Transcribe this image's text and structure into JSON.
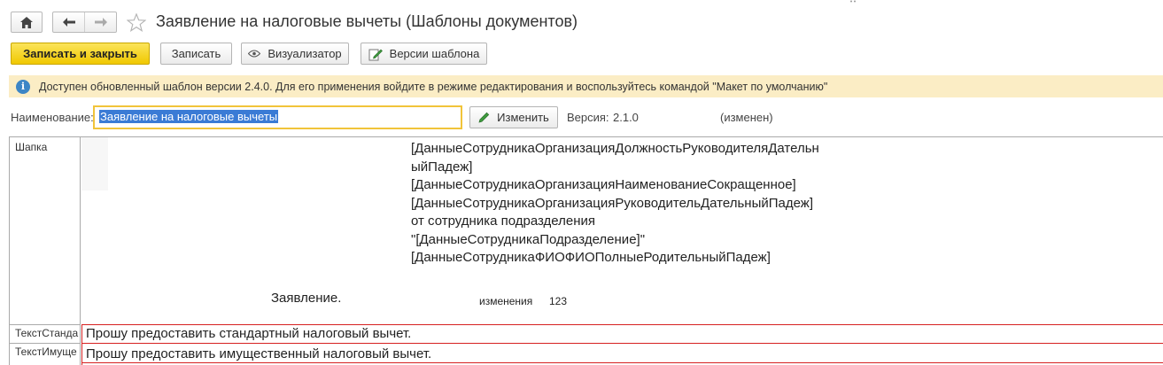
{
  "window": {
    "title": "Заявление на налоговые вычеты (Шаблоны документов)"
  },
  "toolbar": {
    "save_close_label": "Записать и закрыть",
    "save_label": "Записать",
    "visualizer_label": "Визуализатор",
    "versions_label": "Версии шаблона"
  },
  "banner": {
    "text": "Доступен обновленный шаблон версии 2.4.0. Для его применения войдите в режиме редактирования и воспользуйтесь командой \"Макет по умолчанию\""
  },
  "form": {
    "name_label": "Наименование:",
    "name_value": "Заявление на налоговые вычеты",
    "change_label": "Изменить",
    "version_label": "Версия:",
    "version_value": "2.1.0",
    "changed_label": "(изменен)"
  },
  "sheet": {
    "rows": [
      {
        "name": "Шапка"
      },
      {
        "name": "ТекстСтанда"
      },
      {
        "name": "ТекстИмуще"
      }
    ],
    "shapka_lines": [
      "[ДанныеСотрудникаОрганизацияДолжностьРуководителяДательн",
      "ыйПадеж]",
      "[ДанныеСотрудникаОрганизацияНаименованиеСокращенное]",
      "[ДанныеСотрудникаОрганизацияРуководительДательныйПадеж]",
      "от сотрудника подразделения",
      "\"[ДанныеСотрудникаПодразделение]\"",
      "[ДанныеСотрудникаФИОФИОПолныеРодительныйПадеж]"
    ],
    "statement_title": "Заявление.",
    "changes_label": "изменения",
    "changes_value": "123",
    "standard_text": "Прошу предоставить стандартный налоговый вычет.",
    "property_text": "Прошу предоставить имущественный налоговый вычет."
  },
  "icons": {
    "home": "home-icon",
    "back": "arrow-left-icon",
    "forward": "arrow-right-icon",
    "favorite": "star-icon",
    "visualizer": "eye-icon",
    "versions": "edit-document-icon",
    "change": "pencil-icon",
    "info": "info-icon"
  },
  "colors": {
    "primary_button": "#f0c800",
    "banner_bg": "#fbedc5",
    "info_icon": "#3d86c6",
    "focus_border": "#f1c43a",
    "selection": "#3a7bd5",
    "area_border": "#d62020"
  }
}
